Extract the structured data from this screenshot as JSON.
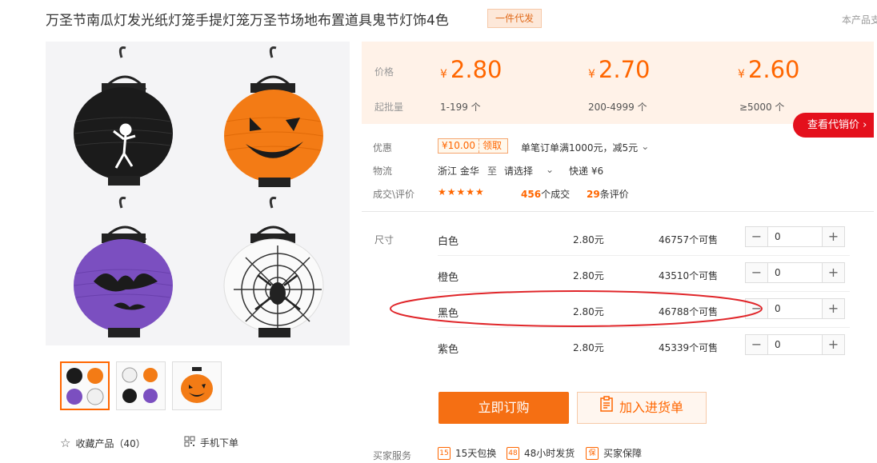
{
  "product": {
    "title": "万圣节南瓜灯发光纸灯笼手提灯笼万圣节场地布置道具鬼节灯饰4色",
    "tag": "一件代发",
    "supply_note": "本产品支"
  },
  "price_table": {
    "price_label": "价格",
    "batch_label": "起批量",
    "currency": "¥",
    "tiers": [
      {
        "price": "2.80",
        "range": "1-199 个"
      },
      {
        "price": "2.70",
        "range": "200-4999 个"
      },
      {
        "price": "2.60",
        "range": "≥5000 个"
      }
    ],
    "agent_button": "查看代销价 ›"
  },
  "promo": {
    "label": "优惠",
    "coupon_amount": "¥10.00",
    "coupon_get": "领取",
    "desc": "单笔订单满1000元，减5元"
  },
  "logistics": {
    "label": "物流",
    "from": "浙江 金华",
    "to_word": "至",
    "select": "请选择",
    "express": "快递 ¥6"
  },
  "deals": {
    "label": "成交\\评价",
    "stars": "★★★★★",
    "deal_count": "456",
    "deal_unit": "个成交",
    "review_count": "29",
    "review_unit": "条评价"
  },
  "sku": {
    "label": "尺寸",
    "rows": [
      {
        "name": "白色",
        "price": "2.80元",
        "stock": "46757个可售",
        "qty": "0"
      },
      {
        "name": "橙色",
        "price": "2.80元",
        "stock": "43510个可售",
        "qty": "0"
      },
      {
        "name": "黑色",
        "price": "2.80元",
        "stock": "46788个可售",
        "qty": "0"
      },
      {
        "name": "紫色",
        "price": "2.80元",
        "stock": "45339个可售",
        "qty": "0"
      }
    ],
    "minus": "−",
    "plus": "+"
  },
  "actions": {
    "order": "立即订购",
    "cart": "加入进货单"
  },
  "left": {
    "favorite": "收藏产品（40）",
    "mobile": "手机下单"
  },
  "service": {
    "label": "买家服务",
    "items": [
      {
        "icon": "15",
        "text": "15天包换"
      },
      {
        "icon": "48",
        "text": "48小时发货"
      },
      {
        "icon": "保",
        "text": "买家保障"
      }
    ]
  },
  "colors": {
    "accent": "#ff6600",
    "red": "#e4101c",
    "highlight_circle": "#e0262a"
  }
}
